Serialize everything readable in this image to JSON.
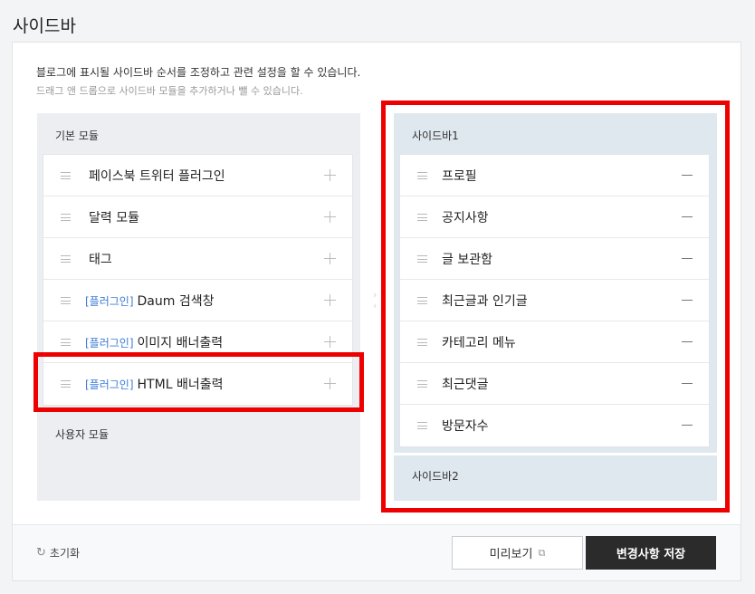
{
  "page": {
    "title": "사이드바"
  },
  "description": {
    "line1": "블로그에 표시될 사이드바 순서를 조정하고 관련 설정을 할 수 있습니다.",
    "line2": "드래그 앤 드롭으로 사이드바 모듈을 추가하거나 뺄 수 있습니다."
  },
  "left": {
    "basic_title": "기본 모듈",
    "items": [
      {
        "tag": "",
        "label": "페이스북 트위터 플러그인"
      },
      {
        "tag": "",
        "label": "달력 모듈"
      },
      {
        "tag": "",
        "label": "태그"
      },
      {
        "tag": "[플러그인]",
        "label": "Daum 검색창"
      },
      {
        "tag": "[플러그인]",
        "label": "이미지 배너출력"
      },
      {
        "tag": "[플러그인]",
        "label": "HTML 배너출력"
      }
    ],
    "user_title": "사용자 모듈"
  },
  "right": {
    "sidebar1_title": "사이드바1",
    "items": [
      {
        "label": "프로필"
      },
      {
        "label": "공지사항"
      },
      {
        "label": "글 보관함"
      },
      {
        "label": "최근글과 인기글"
      },
      {
        "label": "카테고리 메뉴"
      },
      {
        "label": "최근댓글"
      },
      {
        "label": "방문자수"
      }
    ],
    "sidebar2_title": "사이드바2"
  },
  "footer": {
    "reset_label": "초기화",
    "preview_label": "미리보기",
    "save_label": "변경사항 저장"
  },
  "icons": {
    "drag": "drag-handle-icon",
    "add": "plus-icon",
    "remove": "minus-icon",
    "reset": "refresh-icon",
    "external": "external-link-icon"
  },
  "colors": {
    "highlight": "#ee0000",
    "plugin_tag": "#3a7bd5",
    "save_button": "#2b2b2b"
  }
}
